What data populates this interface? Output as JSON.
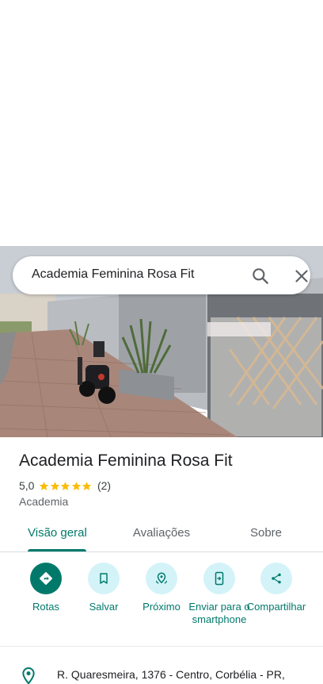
{
  "search": {
    "query": "Academia Feminina Rosa Fit"
  },
  "place": {
    "name": "Academia Feminina Rosa Fit",
    "rating": "5,0",
    "stars": 5,
    "review_count": "(2)",
    "category": "Academia"
  },
  "tabs": [
    {
      "label": "Visão geral",
      "active": true
    },
    {
      "label": "Avaliações",
      "active": false
    },
    {
      "label": "Sobre",
      "active": false
    }
  ],
  "actions": [
    {
      "label": "Rotas",
      "icon": "directions-icon"
    },
    {
      "label": "Salvar",
      "icon": "bookmark-icon"
    },
    {
      "label": "Próximo",
      "icon": "nearby-icon"
    },
    {
      "label": "Enviar para o smartphone",
      "icon": "send-to-phone-icon"
    },
    {
      "label": "Compartilhar",
      "icon": "share-icon"
    }
  ],
  "address": {
    "text": "R. Quaresmeira, 1376 - Centro, Corbélia - PR,"
  },
  "colors": {
    "accent": "#00796b",
    "action_bg": "#d3f3f8",
    "star": "#fbbc04"
  }
}
